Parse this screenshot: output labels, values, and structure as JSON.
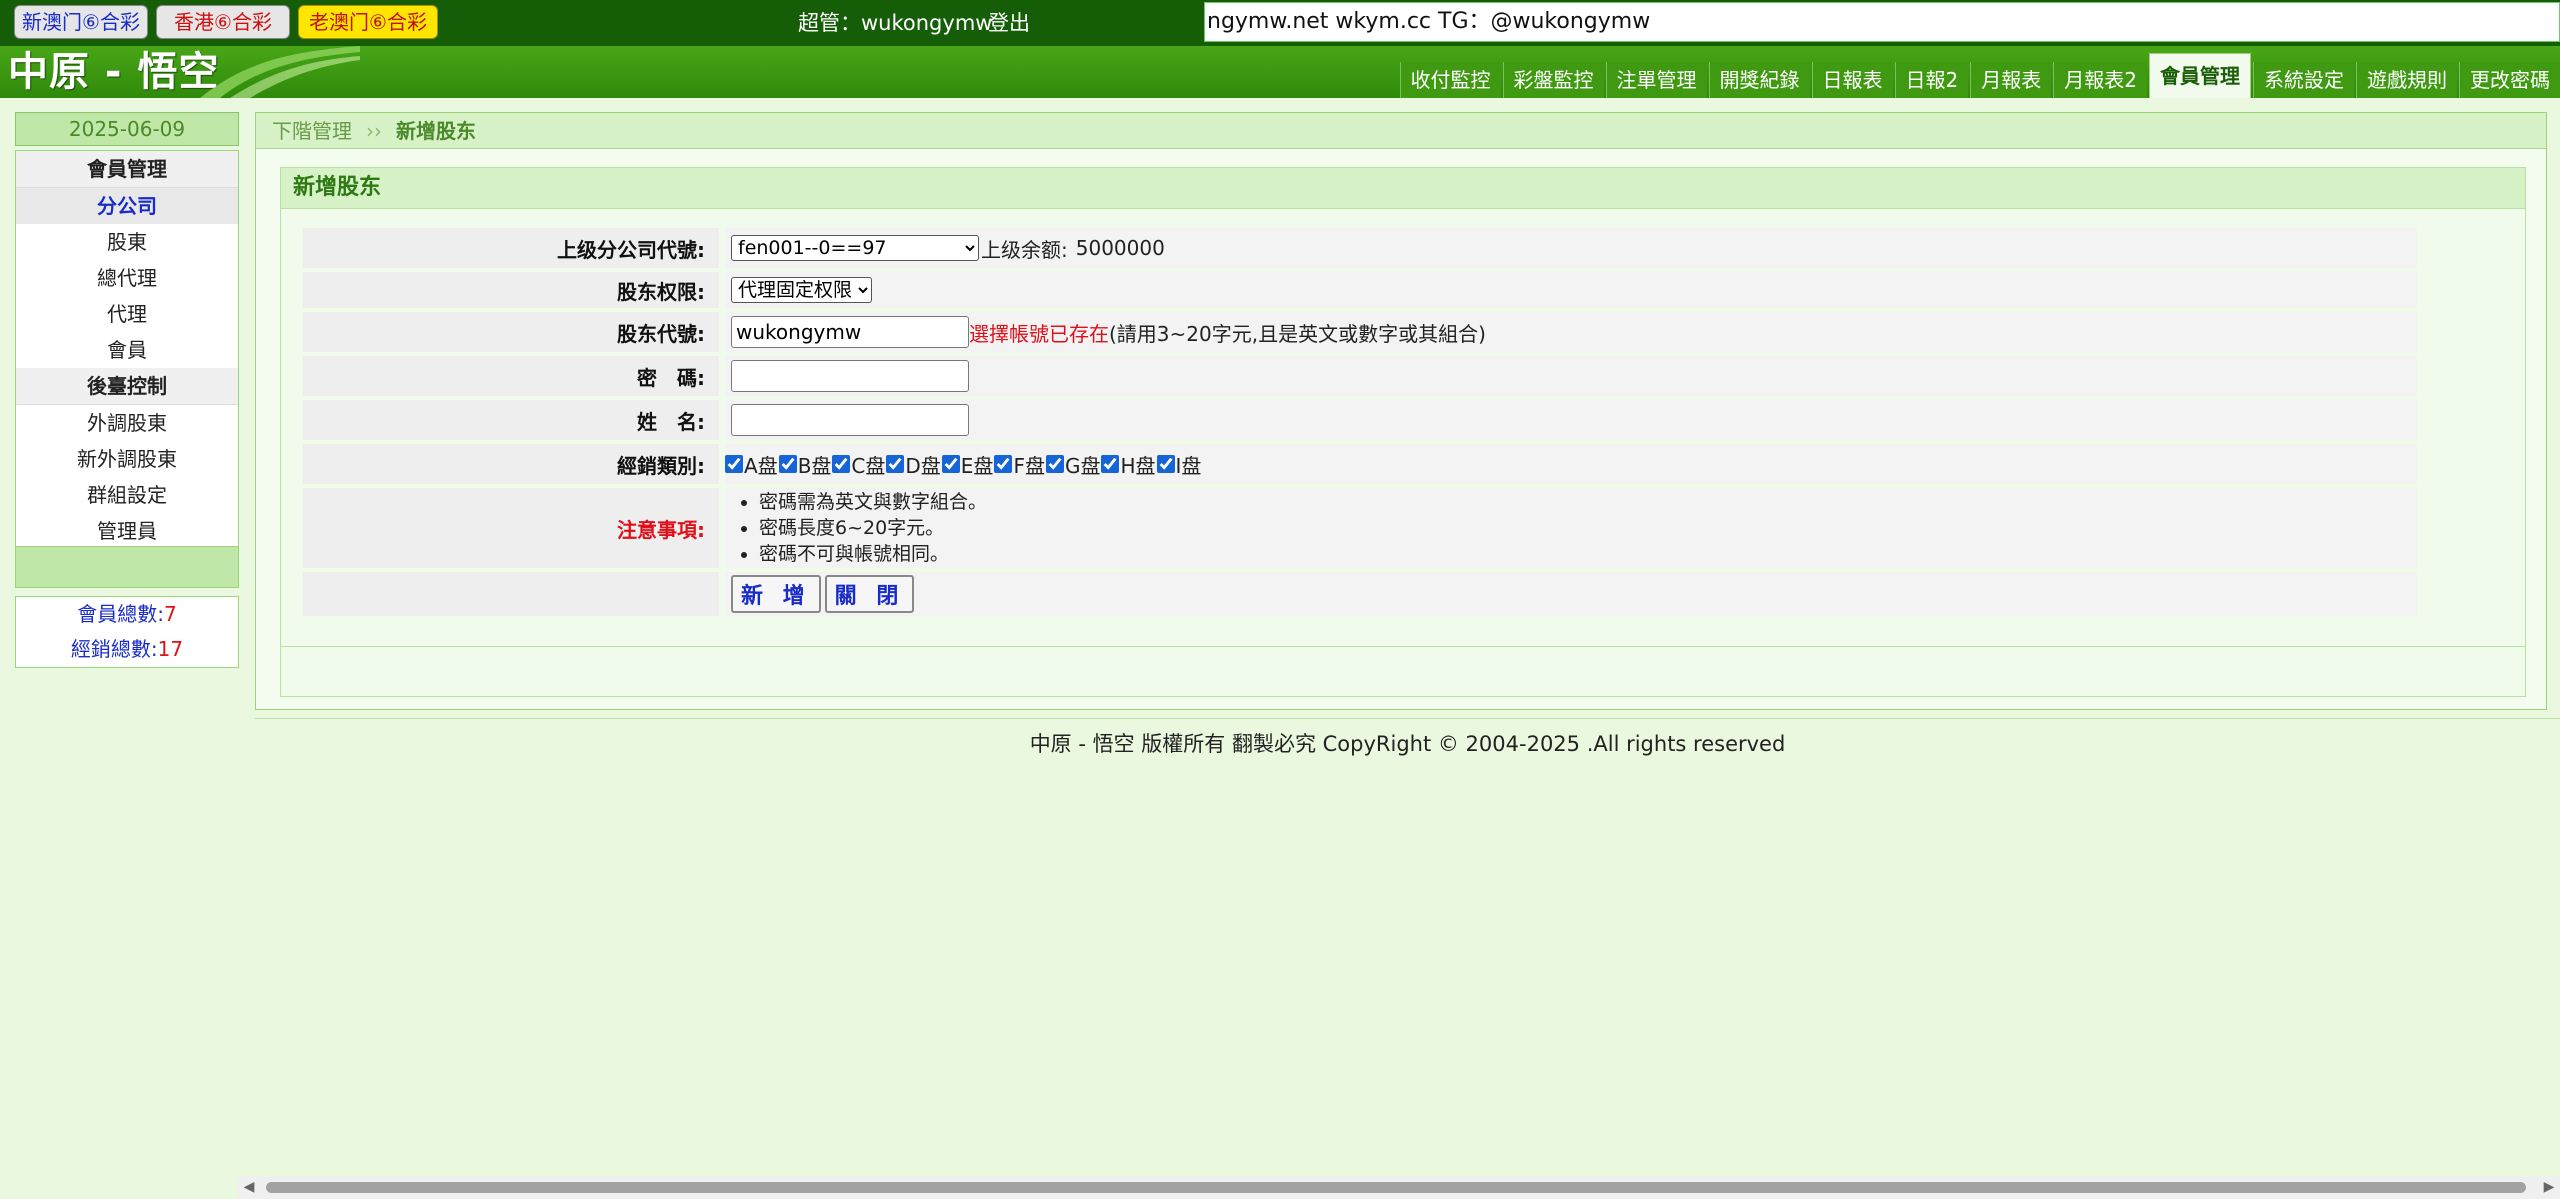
{
  "topbar": {
    "lottery_buttons": [
      "新澳门⑥合彩",
      "香港⑥合彩",
      "老澳门⑥合彩"
    ],
    "admin_text": "超管：wukongymw",
    "logout": "登出",
    "marquee": "ngymw.net wkym.cc TG：@wukongymw"
  },
  "header": {
    "logo": "中原 - 悟空",
    "nav": [
      "收付監控",
      "彩盤監控",
      "注單管理",
      "開獎紀錄",
      "日報表",
      "日報2",
      "月報表",
      "月報表2",
      "會員管理",
      "系統設定",
      "遊戲規則",
      "更改密碼"
    ],
    "active_nav": "會員管理"
  },
  "sidebar": {
    "date": "2025-06-09",
    "section1": "會員管理",
    "items1": [
      "分公司",
      "股東",
      "總代理",
      "代理",
      "會員"
    ],
    "section2": "後臺控制",
    "items2": [
      "外調股東",
      "新外調股東",
      "群組設定",
      "管理員"
    ],
    "stats": [
      {
        "label": "會員總數:",
        "value": "7"
      },
      {
        "label": "經銷總數:",
        "value": "17"
      }
    ]
  },
  "breadcrumb": {
    "parent": "下階管理",
    "separator": "››",
    "current": "新增股东"
  },
  "form": {
    "title": "新增股东",
    "parent_label": "上级分公司代號:",
    "parent_value": "fen001--0==97",
    "balance_label": "上级余额:",
    "balance_value": "5000000",
    "permission_label": "股东权限:",
    "permission_value": "代理固定权限",
    "code_label": "股东代號:",
    "code_value": "wukongymw",
    "code_error": "選擇帳號已存在",
    "code_hint": "(請用3~20字元,且是英文或數字或其組合)",
    "password_label": "密　碼:",
    "name_label": "姓　名:",
    "category_label": "經銷類別:",
    "categories": [
      "A盘",
      "B盘",
      "C盘",
      "D盘",
      "E盘",
      "F盘",
      "G盘",
      "H盘",
      "I盘"
    ],
    "notes_label": "注意事項:",
    "notes": [
      "密碼需為英文與數字組合。",
      "密碼長度6~20字元。",
      "密碼不可與帳號相同。"
    ],
    "add_button": "新 增",
    "close_button": "關 閉"
  },
  "footer": {
    "text": "中原 - 悟空 版權所有 翻製必究 CopyRight © 2004-2025 .All rights reserved"
  },
  "colors": {
    "topbar_bg": "#155e07",
    "header_green": "#3f9a12",
    "page_bg": "#e9f8df",
    "warn_red": "#e0101a",
    "link_blue": "#1a2cc7"
  }
}
